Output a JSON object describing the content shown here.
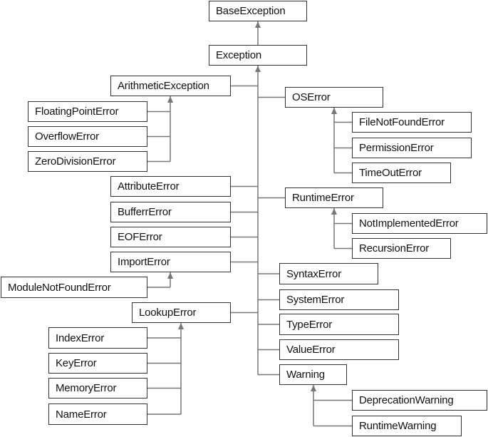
{
  "diagram": {
    "line_color": "#777777",
    "border_color": "#333333",
    "nodes": [
      {
        "id": "BaseException",
        "label": "BaseException",
        "parent": null
      },
      {
        "id": "Exception",
        "label": "Exception",
        "parent": "BaseException"
      },
      {
        "id": "ArithmeticException",
        "label": "ArithmeticException",
        "parent": "Exception"
      },
      {
        "id": "FloatingPointError",
        "label": "FloatingPointError",
        "parent": "ArithmeticException"
      },
      {
        "id": "OverflowError",
        "label": "OverflowError",
        "parent": "ArithmeticException"
      },
      {
        "id": "ZeroDivisionError",
        "label": "ZeroDivisionError",
        "parent": "ArithmeticException"
      },
      {
        "id": "AttributeError",
        "label": "AttributeError",
        "parent": "Exception"
      },
      {
        "id": "BufferrError",
        "label": "BufferrError",
        "parent": "Exception"
      },
      {
        "id": "EOFError",
        "label": "EOFError",
        "parent": "Exception"
      },
      {
        "id": "ImportError",
        "label": "ImportError",
        "parent": "Exception"
      },
      {
        "id": "ModuleNotFoundError",
        "label": "ModuleNotFoundError",
        "parent": "ImportError"
      },
      {
        "id": "LookupError",
        "label": "LookupError",
        "parent": "Exception"
      },
      {
        "id": "IndexError",
        "label": "IndexError",
        "parent": "LookupError"
      },
      {
        "id": "KeyError",
        "label": "KeyError",
        "parent": "LookupError"
      },
      {
        "id": "MemoryError",
        "label": "MemoryError",
        "parent": "LookupError"
      },
      {
        "id": "NameError",
        "label": "NameError",
        "parent": "LookupError"
      },
      {
        "id": "OSError",
        "label": "OSError",
        "parent": "Exception"
      },
      {
        "id": "FileNotFoundError",
        "label": "FileNotFoundError",
        "parent": "OSError"
      },
      {
        "id": "PermissionError",
        "label": "PermissionError",
        "parent": "OSError"
      },
      {
        "id": "TimeOutError",
        "label": "TimeOutError",
        "parent": "OSError"
      },
      {
        "id": "RuntimeError",
        "label": "RuntimeError",
        "parent": "Exception"
      },
      {
        "id": "NotImplementedError",
        "label": "NotImplementedError",
        "parent": "RuntimeError"
      },
      {
        "id": "RecursionError",
        "label": "RecursionError",
        "parent": "RuntimeError"
      },
      {
        "id": "SyntaxError",
        "label": "SyntaxError",
        "parent": "Exception"
      },
      {
        "id": "SystemError",
        "label": "SystemError",
        "parent": "Exception"
      },
      {
        "id": "TypeError",
        "label": "TypeError",
        "parent": "Exception"
      },
      {
        "id": "ValueError",
        "label": "ValueError",
        "parent": "Exception"
      },
      {
        "id": "Warning",
        "label": "Warning",
        "parent": "Exception"
      },
      {
        "id": "DeprecationWarning",
        "label": "DeprecationWarning",
        "parent": "Warning"
      },
      {
        "id": "RuntimeWarning",
        "label": "RuntimeWarning",
        "parent": "Warning"
      }
    ]
  }
}
